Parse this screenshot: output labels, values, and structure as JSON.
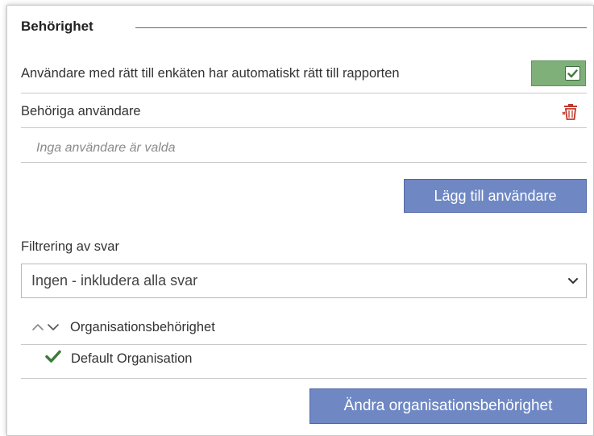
{
  "section": {
    "title": "Behörighet"
  },
  "auto_access": {
    "label": "Användare med rätt till enkäten har automatiskt rätt till rapporten",
    "checked": true
  },
  "users": {
    "label": "Behöriga användare",
    "empty_text": "Inga användare är valda",
    "add_button": "Lägg till användare"
  },
  "filter": {
    "label": "Filtrering av svar",
    "selected": "Ingen - inkludera alla svar"
  },
  "organisation": {
    "header": "Organisationsbehörighet",
    "items": [
      "Default Organisation"
    ],
    "change_button": "Ändra organisationsbehörighet"
  },
  "colors": {
    "toggle_green": "#7fb07a",
    "button_blue": "#6f88c4",
    "check_green": "#3f7a3a",
    "trash_red": "#c0392b"
  }
}
